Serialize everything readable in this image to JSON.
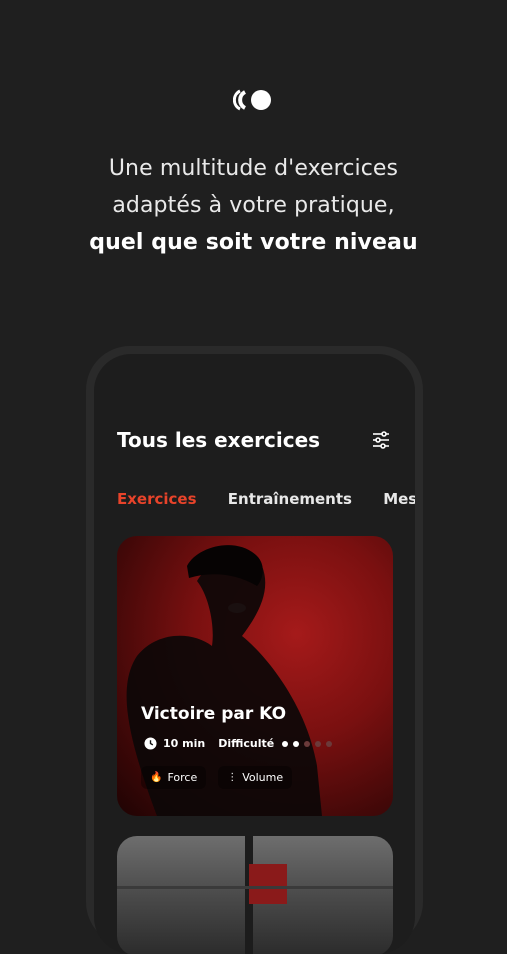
{
  "headline": {
    "line1": "Une multitude d'exercices",
    "line2": "adaptés à votre pratique,",
    "line3": "quel que soit votre niveau"
  },
  "screen": {
    "title": "Tous les exercices",
    "tabs": [
      "Exercices",
      "Entraînements",
      "Mes f"
    ],
    "active_tab": "Exercices",
    "card": {
      "title": "Victoire par KO",
      "duration": "10 min",
      "difficulty_label": "Difficulté",
      "difficulty_level": 2,
      "difficulty_max": 5,
      "tags": [
        {
          "icon": "flame-icon",
          "label": "Force"
        },
        {
          "icon": "dumbbell-icon",
          "label": "Volume"
        }
      ]
    }
  },
  "colors": {
    "accent": "#e8432a",
    "background": "#1f1f1f"
  }
}
